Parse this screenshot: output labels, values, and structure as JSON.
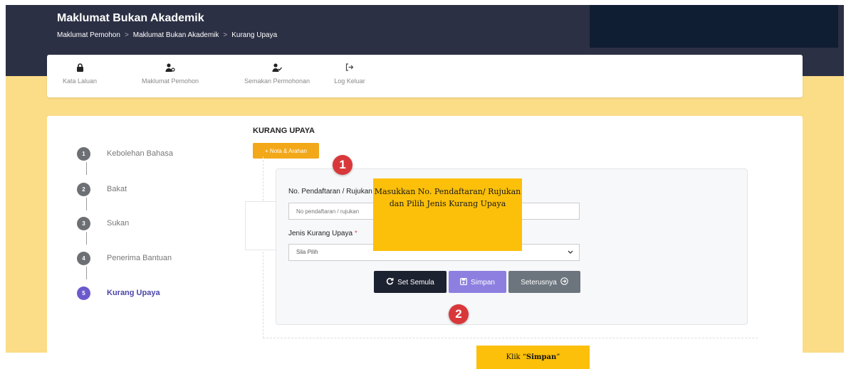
{
  "header": {
    "title": "Maklumat Bukan Akademik",
    "breadcrumb": [
      "Maklumat Pemohon",
      "Maklumat Bukan Akademik",
      "Kurang Upaya"
    ],
    "separator": ">"
  },
  "nav": [
    {
      "icon": "lock-icon",
      "glyph": "🔒",
      "label": "Kata Laluan"
    },
    {
      "icon": "user-plus-icon",
      "glyph": "👤",
      "label": "Maklumat Pemohon"
    },
    {
      "icon": "user-check-icon",
      "glyph": "👤",
      "label": "Semakan Permohonan"
    },
    {
      "icon": "sign-out-icon",
      "glyph": "↪",
      "label": "Log Keluar"
    }
  ],
  "steps": [
    {
      "num": "1",
      "label": "Kebolehan Bahasa"
    },
    {
      "num": "2",
      "label": "Bakat"
    },
    {
      "num": "3",
      "label": "Sukan"
    },
    {
      "num": "4",
      "label": "Penerima Bantuan"
    },
    {
      "num": "5",
      "label": "Kurang Upaya"
    }
  ],
  "form": {
    "section_title": "KURANG UPAYA",
    "nota_button": "+ Nota & Arahan",
    "ref_label": "No. Pendaftaran / Rujukan",
    "ref_value": "",
    "ref_placeholder": "No pendaftaran / rujukan",
    "type_label": "Jenis Kurang Upaya",
    "required_mark": "*",
    "type_selected": "Sila Pilih",
    "reset_button": "Set Semula",
    "save_button": "Simpan",
    "next_button": "Seterusnya"
  },
  "annotations": {
    "callout_text": "Masukkan No. Pendaftaran/ Rujukan dan Pilih Jenis Kurang Upaya",
    "badge1": "1",
    "badge2": "2",
    "klik_prefix": "Klik “",
    "klik_bold": "Simpan",
    "klik_suffix": "”"
  },
  "colors": {
    "header_bg": "#2c3044",
    "page_bg": "#fbdc87",
    "nota_button": "#f2a818",
    "reset_button": "#1d2230",
    "save_button": "#8c7fe0",
    "next_button": "#6c757d",
    "step_active": "#6a5acd",
    "callout": "#fcc00a",
    "badge": "#d9383a"
  }
}
